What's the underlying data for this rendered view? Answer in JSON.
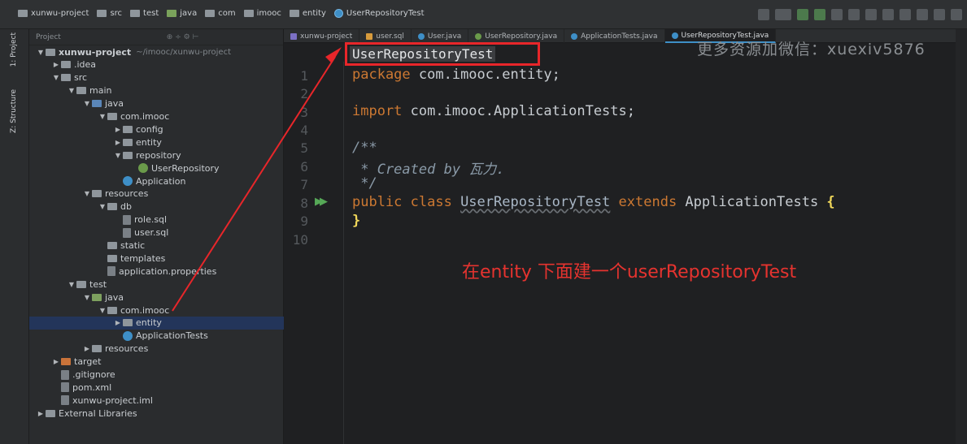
{
  "breadcrumb": [
    "xunwu-project",
    "src",
    "test",
    "java",
    "com",
    "imooc",
    "entity",
    "UserRepositoryTest"
  ],
  "side_tabs": {
    "project": "1: Project",
    "structure": "Z: Structure"
  },
  "project_panel": {
    "header_label": "Project",
    "tree": [
      {
        "label": "xunwu-project",
        "path": "~/imooc/xunwu-project",
        "depth": 0,
        "arrow": "open",
        "icon": "folder"
      },
      {
        "label": ".idea",
        "depth": 1,
        "arrow": "closed",
        "icon": "folder"
      },
      {
        "label": "src",
        "depth": 1,
        "arrow": "open",
        "icon": "folder"
      },
      {
        "label": "main",
        "depth": 2,
        "arrow": "open",
        "icon": "folder"
      },
      {
        "label": "java",
        "depth": 3,
        "arrow": "open",
        "icon": "folder-blue"
      },
      {
        "label": "com.imooc",
        "depth": 4,
        "arrow": "open",
        "icon": "package"
      },
      {
        "label": "config",
        "depth": 5,
        "arrow": "closed",
        "icon": "package"
      },
      {
        "label": "entity",
        "depth": 5,
        "arrow": "closed",
        "icon": "package"
      },
      {
        "label": "repository",
        "depth": 5,
        "arrow": "open",
        "icon": "package"
      },
      {
        "label": "UserRepository",
        "depth": 6,
        "arrow": "none",
        "icon": "interface"
      },
      {
        "label": "Application",
        "depth": 5,
        "arrow": "none",
        "icon": "class"
      },
      {
        "label": "resources",
        "depth": 3,
        "arrow": "open",
        "icon": "folder"
      },
      {
        "label": "db",
        "depth": 4,
        "arrow": "open",
        "icon": "folder"
      },
      {
        "label": "role.sql",
        "depth": 5,
        "arrow": "none",
        "icon": "file"
      },
      {
        "label": "user.sql",
        "depth": 5,
        "arrow": "none",
        "icon": "file"
      },
      {
        "label": "static",
        "depth": 4,
        "arrow": "none",
        "icon": "folder"
      },
      {
        "label": "templates",
        "depth": 4,
        "arrow": "none",
        "icon": "folder"
      },
      {
        "label": "application.properties",
        "depth": 4,
        "arrow": "none",
        "icon": "file"
      },
      {
        "label": "test",
        "depth": 2,
        "arrow": "open",
        "icon": "folder"
      },
      {
        "label": "java",
        "depth": 3,
        "arrow": "open",
        "icon": "folder-green"
      },
      {
        "label": "com.imooc",
        "depth": 4,
        "arrow": "open",
        "icon": "package"
      },
      {
        "label": "entity",
        "depth": 5,
        "arrow": "closed",
        "icon": "package",
        "selected": true
      },
      {
        "label": "ApplicationTests",
        "depth": 5,
        "arrow": "none",
        "icon": "class"
      },
      {
        "label": "resources",
        "depth": 3,
        "arrow": "closed",
        "icon": "folder"
      },
      {
        "label": "target",
        "depth": 1,
        "arrow": "closed",
        "icon": "folder-orange"
      },
      {
        "label": ".gitignore",
        "depth": 1,
        "arrow": "none",
        "icon": "file"
      },
      {
        "label": "pom.xml",
        "depth": 1,
        "arrow": "none",
        "icon": "file"
      },
      {
        "label": "xunwu-project.iml",
        "depth": 1,
        "arrow": "none",
        "icon": "file"
      },
      {
        "label": "External Libraries",
        "depth": 0,
        "arrow": "closed",
        "icon": "library"
      }
    ]
  },
  "editor": {
    "tabs": [
      {
        "label": "xunwu-project",
        "icon": "module",
        "active": false
      },
      {
        "label": "user.sql",
        "icon": "sql",
        "active": false
      },
      {
        "label": "User.java",
        "icon": "class",
        "active": false
      },
      {
        "label": "UserRepository.java",
        "icon": "interface",
        "active": false
      },
      {
        "label": "ApplicationTests.java",
        "icon": "class",
        "active": false
      },
      {
        "label": "UserRepositoryTest.java",
        "icon": "class",
        "active": true
      }
    ],
    "file_title": "UserRepositoryTest",
    "line_numbers": [
      "1",
      "2",
      "3",
      "4",
      "5",
      "6",
      "7",
      "8",
      "9",
      "10"
    ],
    "code": {
      "l1_kw": "package",
      "l1_rest": " com.imooc.entity;",
      "l3_kw": "import",
      "l3_rest": " com.imooc.ApplicationTests;",
      "l5": "/**",
      "l6": " * Created by 瓦力.",
      "l7": " */",
      "l8_kw1": "public class ",
      "l8_cls": "UserRepositoryTest",
      "l8_kw2": " extends ",
      "l8_rest": "ApplicationTests",
      "l8_brace": " {",
      "l9": "}"
    }
  },
  "watermark": "更多资源加微信：xuexiv5876",
  "annotation": "在entity 下面建一个userRepositoryTest",
  "colors": {
    "annotation_red": "#e5332f",
    "highlight_box": "#e8262a",
    "selection": "#23355a"
  }
}
